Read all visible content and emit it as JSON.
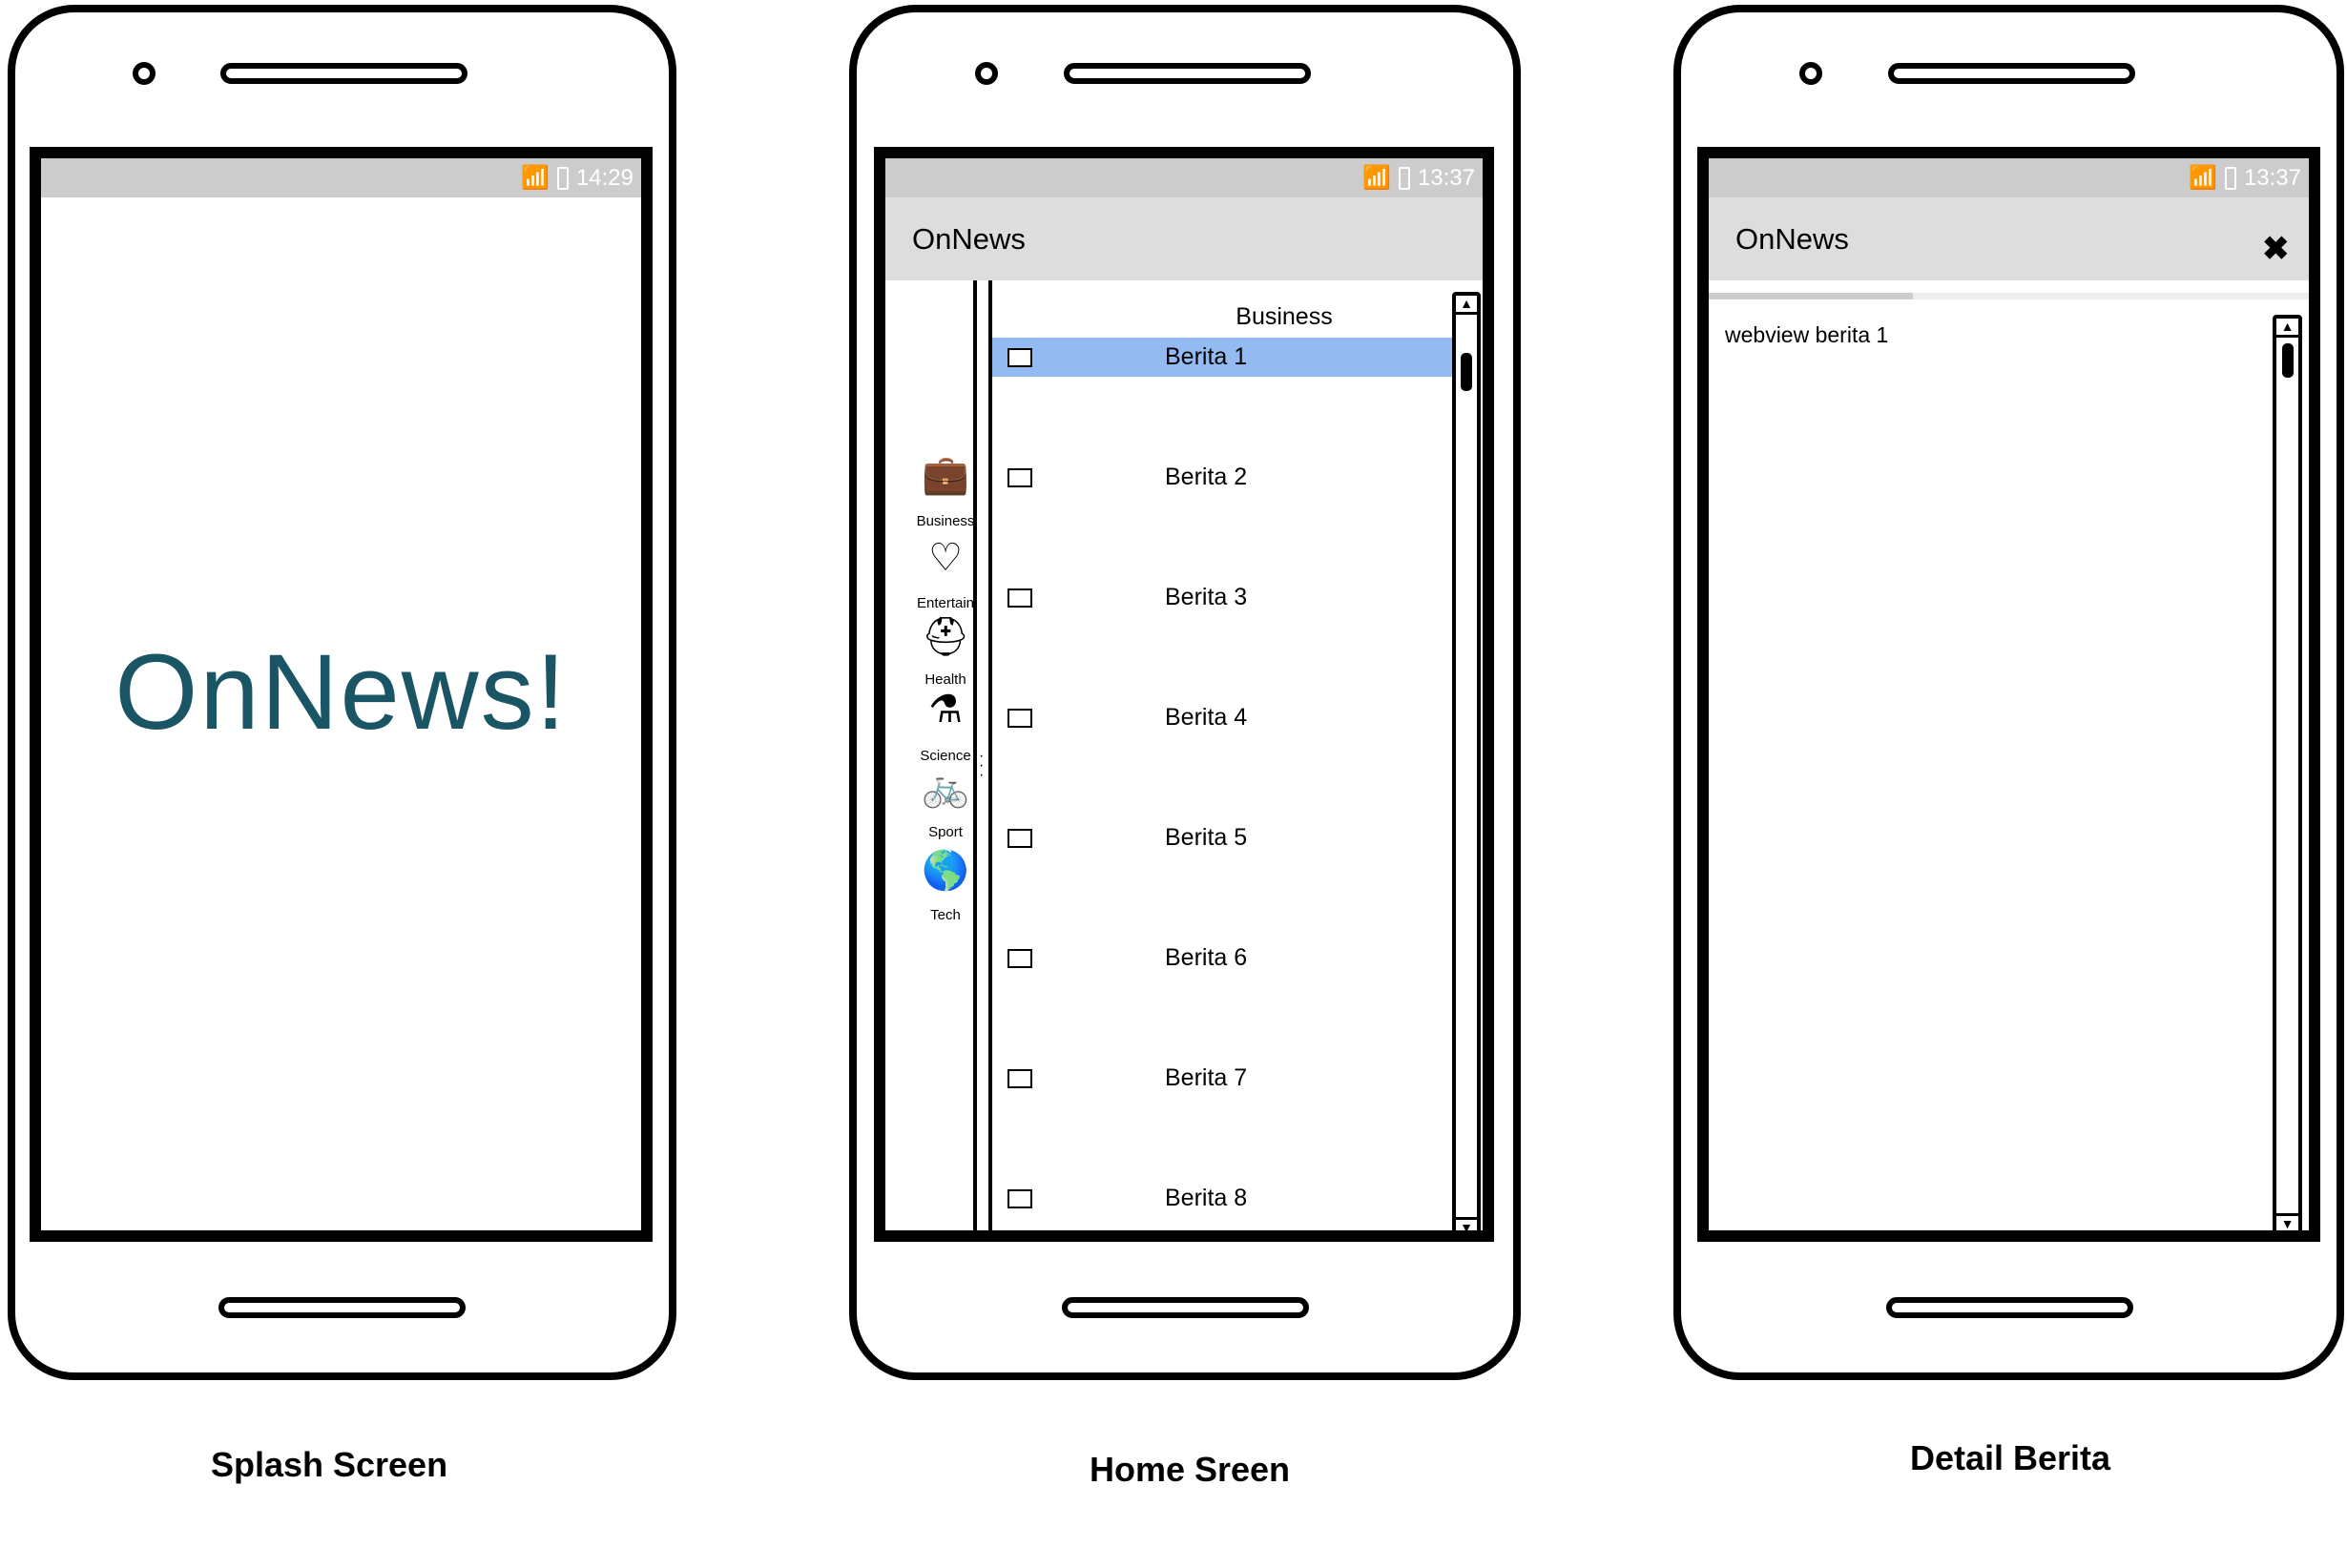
{
  "splash": {
    "status_time": "14:29",
    "logo_text": "OnNews!",
    "logo_color": "#1a5566",
    "caption": "Splash Screen"
  },
  "home": {
    "status_time": "13:37",
    "app_title": "OnNews",
    "list_header": "Business",
    "caption": "Home Sreen",
    "highlight_color": "#93bbf1",
    "categories": [
      {
        "label": "Business",
        "icon": "briefcase-icon"
      },
      {
        "label": "Entertain",
        "icon": "heart-icon"
      },
      {
        "label": "Health",
        "icon": "medical-kit-icon"
      },
      {
        "label": "Science",
        "icon": "flask-icon"
      },
      {
        "label": "Sport",
        "icon": "bicycle-icon"
      },
      {
        "label": "Tech",
        "icon": "globe-icon"
      }
    ],
    "items": [
      "Berita 1",
      "Berita 2",
      "Berita 3",
      "Berita 4",
      "Berita 5",
      "Berita 6",
      "Berita 7",
      "Berita 8"
    ],
    "selected_index": 0
  },
  "detail": {
    "status_time": "13:37",
    "app_title": "OnNews",
    "close_icon": "close-icon",
    "webview_text": "webview berita 1",
    "caption": "Detail Berita",
    "progress_percent": 34
  }
}
